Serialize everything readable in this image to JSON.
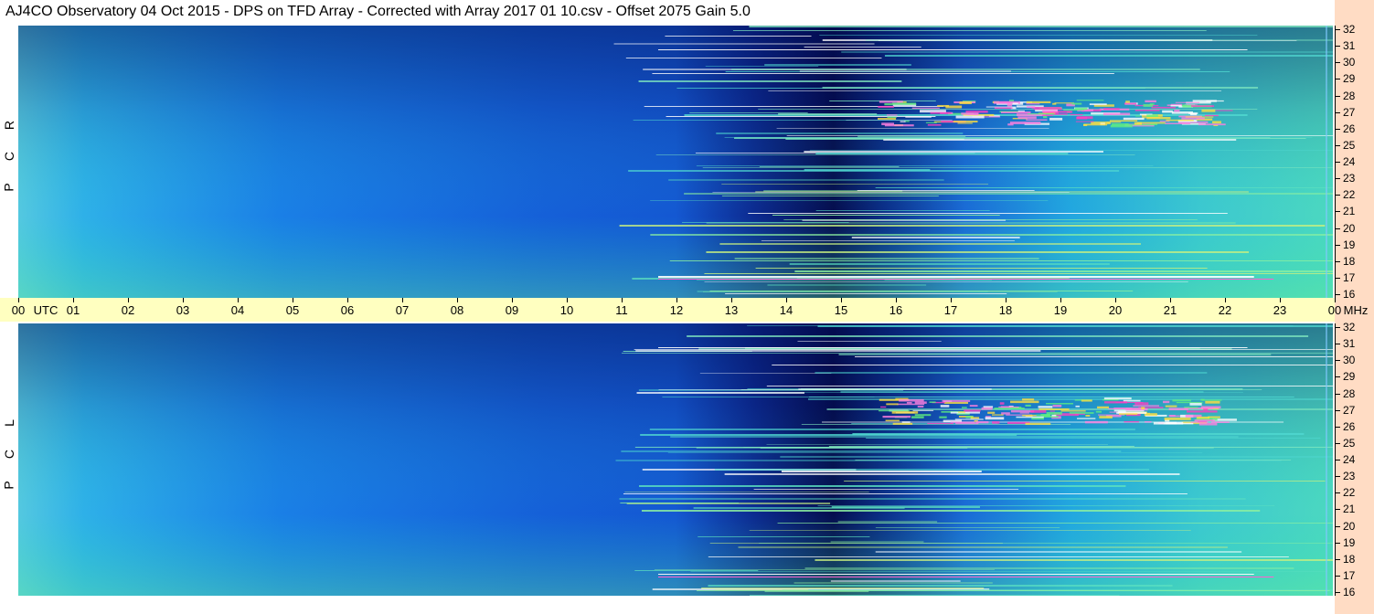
{
  "title": "AJ4CO Observatory  04 Oct 2015  -  DPS on TFD Array  -  Corrected with Array 2017 01 10.csv  -  Offset 2075  Gain 5.0",
  "panels": [
    {
      "label": [
        "R",
        "C",
        "P"
      ]
    },
    {
      "label": [
        "L",
        "C",
        "P"
      ]
    }
  ],
  "chart_data": {
    "type": "heatmap",
    "title": "AJ4CO Observatory  04 Oct 2015  -  DPS on TFD Array  -  Corrected with Array 2017 01 10.csv  -  Offset 2075  Gain 5.0",
    "xlabel": "UTC",
    "ylabel": "MHz",
    "x_ticks": [
      "00",
      "01",
      "02",
      "03",
      "04",
      "05",
      "06",
      "07",
      "08",
      "09",
      "10",
      "11",
      "12",
      "13",
      "14",
      "15",
      "16",
      "17",
      "18",
      "19",
      "20",
      "21",
      "22",
      "23",
      "00"
    ],
    "y_ticks": [
      16,
      17,
      18,
      19,
      20,
      21,
      22,
      23,
      24,
      25,
      26,
      27,
      28,
      29,
      30,
      31,
      32
    ],
    "xlim": [
      0,
      24
    ],
    "ylim": [
      16,
      32
    ],
    "series": [
      {
        "name": "R C P"
      },
      {
        "name": "L C P"
      }
    ],
    "colors": {
      "low": "#000c5a",
      "mid": "#1e8cf0",
      "high": "#4ce8c8",
      "peak": "#ff40c0"
    }
  },
  "axis_labels": {
    "utc": "UTC",
    "mhz": "MHz"
  },
  "colors": {
    "background": "#ffffff",
    "utc_bar": "#ffffc0",
    "right_strip": "#ffdcc4"
  }
}
